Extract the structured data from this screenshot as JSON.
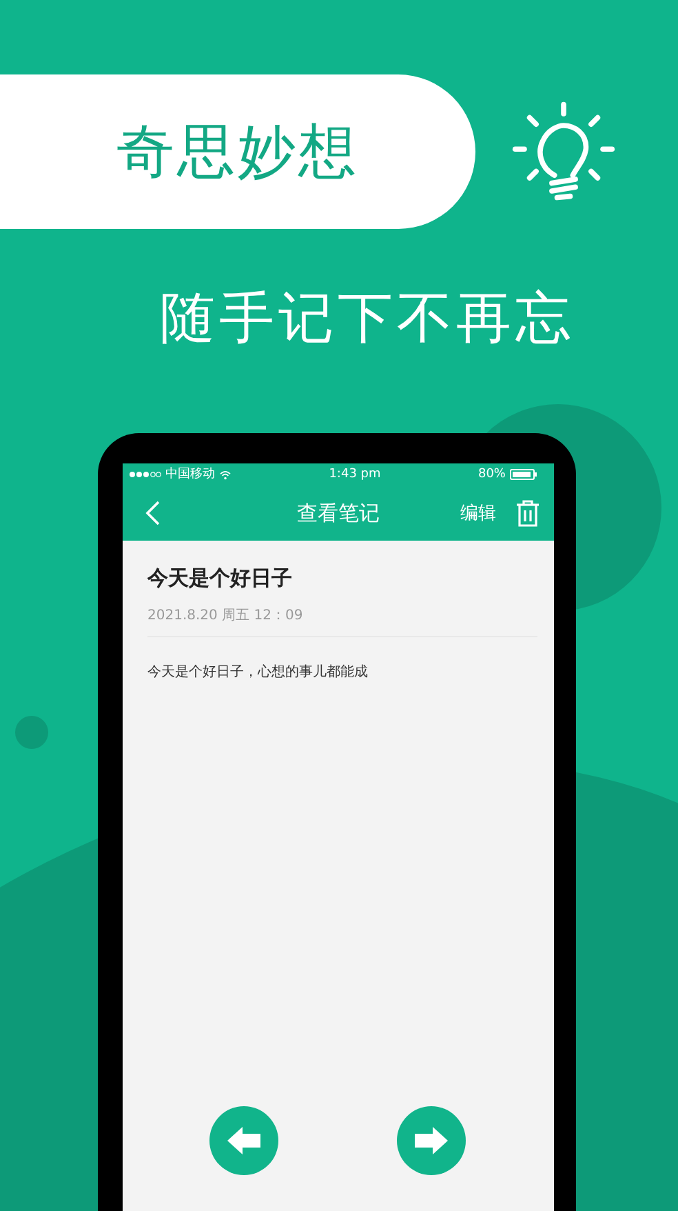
{
  "header": {
    "title": "奇思妙想",
    "subtitle": "随手记下不再忘"
  },
  "phone": {
    "status_bar": {
      "carrier": "中国移动",
      "time": "1:43 pm",
      "battery": "80%"
    },
    "nav": {
      "title": "查看笔记",
      "edit": "编辑"
    },
    "note": {
      "title": "今天是个好日子",
      "date": "2021.8.20 周五 12：09",
      "body": "今天是个好日子，心想的事儿都能成"
    }
  }
}
